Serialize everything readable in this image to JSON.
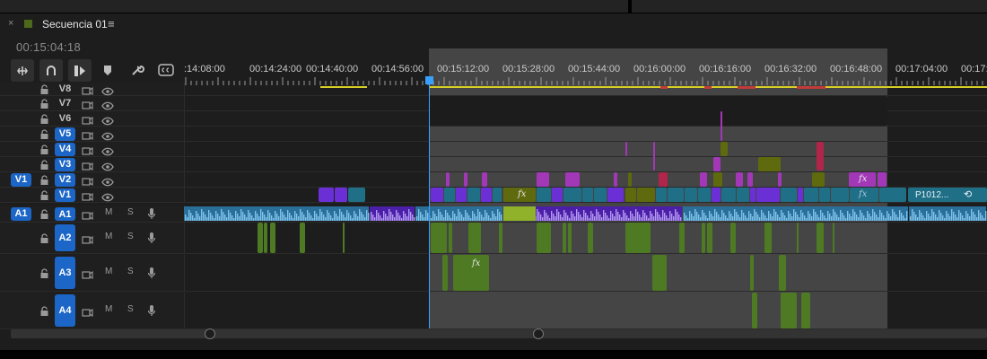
{
  "panel": {
    "close_symbol": "×",
    "sequence_title": "Secuencia 01",
    "menu_symbol": "≡",
    "timecode": "00:15:04:18"
  },
  "tools": [
    {
      "name": "snap-in-sequence-icon"
    },
    {
      "name": "linked-selection-icon"
    },
    {
      "name": "insert-edit-icon"
    },
    {
      "name": "add-marker-icon"
    },
    {
      "name": "wrench-settings-icon"
    },
    {
      "name": "captions-icon"
    }
  ],
  "ruler": {
    "labels": [
      ":14:08:00",
      "00:14:24:00",
      "00:14:40:00",
      "00:14:56:00",
      "00:15:12:00",
      "00:15:28:00",
      "00:15:44:00",
      "00:16:00:00",
      "00:16:16:00",
      "00:16:32:00",
      "00:16:48:00",
      "00:17:04:00",
      "00:17:1"
    ]
  },
  "tracks": {
    "v8": {
      "label": "V8"
    },
    "v7": {
      "label": "V7"
    },
    "v6": {
      "label": "V6"
    },
    "v5": {
      "label": "V5"
    },
    "v4": {
      "label": "V4"
    },
    "v3": {
      "label": "V3"
    },
    "v2": {
      "label": "V2",
      "source": "V1"
    },
    "v1": {
      "label": "V1"
    },
    "a1": {
      "label": "A1",
      "source": "A1",
      "mute": "M",
      "solo": "S"
    },
    "a2": {
      "label": "A2",
      "mute": "M",
      "solo": "S"
    },
    "a3": {
      "label": "A3",
      "mute": "M",
      "solo": "S"
    },
    "a4": {
      "label": "A4",
      "mute": "M",
      "solo": "S"
    }
  },
  "clips": {
    "fx_label": "fx",
    "v1_clip_name": "P1012..."
  },
  "colors": {
    "accent": "#1c66c7",
    "playhead": "#3aa0ff",
    "clip_purple": "#6b2fd6",
    "clip_teal": "#1f6f86",
    "clip_magenta": "#a238b8",
    "clip_olive": "#5e6a0d",
    "clip_red": "#b0254a",
    "audio_green": "#4d7a22",
    "audio_wave": "#7ec3ea"
  }
}
